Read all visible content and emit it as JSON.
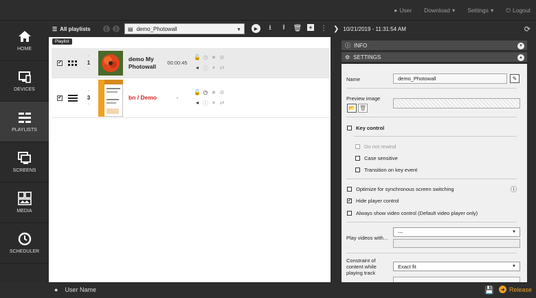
{
  "topnav": {
    "user": "User",
    "download": "Download",
    "settings": "Settings",
    "logout": "Logout"
  },
  "sidebar": {
    "items": [
      {
        "label": "HOME",
        "icon": "home-icon"
      },
      {
        "label": "DEVICES",
        "icon": "devices-icon"
      },
      {
        "label": "PLAYLISTS",
        "icon": "playlists-icon",
        "active": true
      },
      {
        "label": "SCREENS",
        "icon": "screens-icon"
      },
      {
        "label": "MEDIA",
        "icon": "media-icon"
      },
      {
        "label": "SCHEDULER",
        "icon": "clock-icon"
      }
    ]
  },
  "toolbar": {
    "all_playlists": "All playlists",
    "selected_playlist": "demo_Photowall",
    "tooltip": "Playlist"
  },
  "playlist_rows": [
    {
      "index": "1",
      "name": "demo My Photowall",
      "duration": "00:00:45",
      "checked": true,
      "type": "grid"
    },
    {
      "index": "3",
      "name": "bn / Demo",
      "duration": "-",
      "checked": true,
      "type": "list"
    }
  ],
  "right_panel": {
    "timestamp": "10/21/2019 - 11:31:54 AM",
    "info_title": "INFO",
    "settings_title": "SETTINGS",
    "name_label": "Name",
    "name_value": "demo_Photowall",
    "preview_label": "Preview image",
    "key_control": "Key control",
    "do_not_rewind": "Do not rewind",
    "case_sensitive": "Case sensitive",
    "transition_on_key": "Transition on key event",
    "optimize_sync": "Optimize for synchronous screen switching",
    "hide_player_control": "Hide player control",
    "always_show_video": "Always show video control (Default video player only)",
    "play_videos_label": "Play videos with...",
    "play_videos_value": "---",
    "constraint_label": "Constraint of content while playing track",
    "constraint_value": "Exact fit"
  },
  "footer": {
    "user_name": "User Name",
    "release": "Release"
  },
  "colors": {
    "accent": "#f0a020",
    "dark": "#2d2d2d",
    "selected_row": "#eaeaea",
    "red_name": "#d22222"
  }
}
